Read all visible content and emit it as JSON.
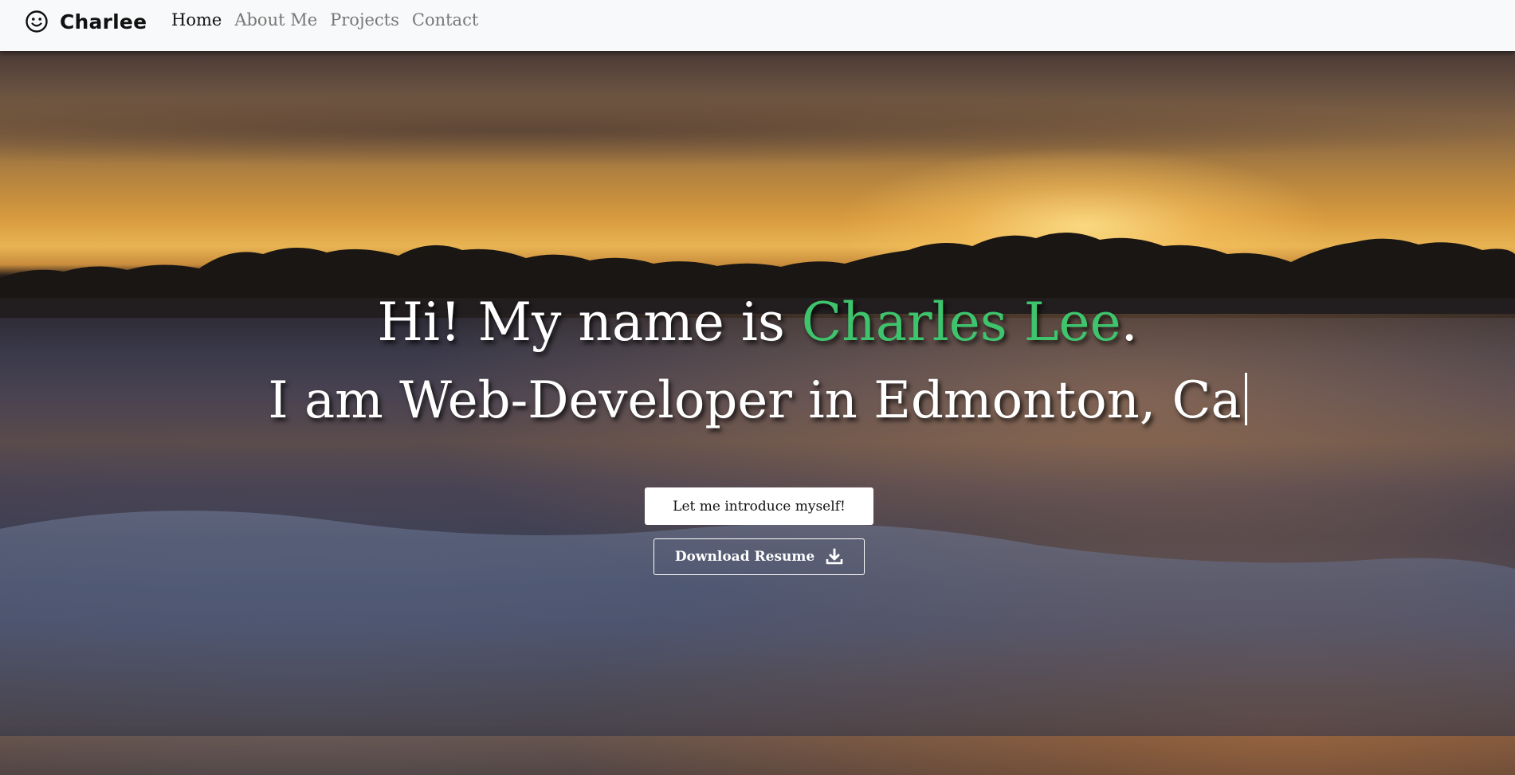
{
  "navbar": {
    "brand_icon": "smiley-face-icon",
    "brand_name": "Charlee",
    "links": [
      {
        "label": "Home",
        "active": true
      },
      {
        "label": "About Me",
        "active": false
      },
      {
        "label": "Projects",
        "active": false
      },
      {
        "label": "Contact",
        "active": false
      }
    ]
  },
  "hero": {
    "greeting_prefix": "Hi! My name is ",
    "name": "Charles Lee",
    "greeting_suffix": ".",
    "typed_text": "I am Web-Developer in Edmonton, Ca",
    "name_color": "#3ec46d",
    "intro_button_label": "Let me introduce myself!",
    "resume_button_label": "Download Resume",
    "resume_button_icon": "download-icon"
  }
}
